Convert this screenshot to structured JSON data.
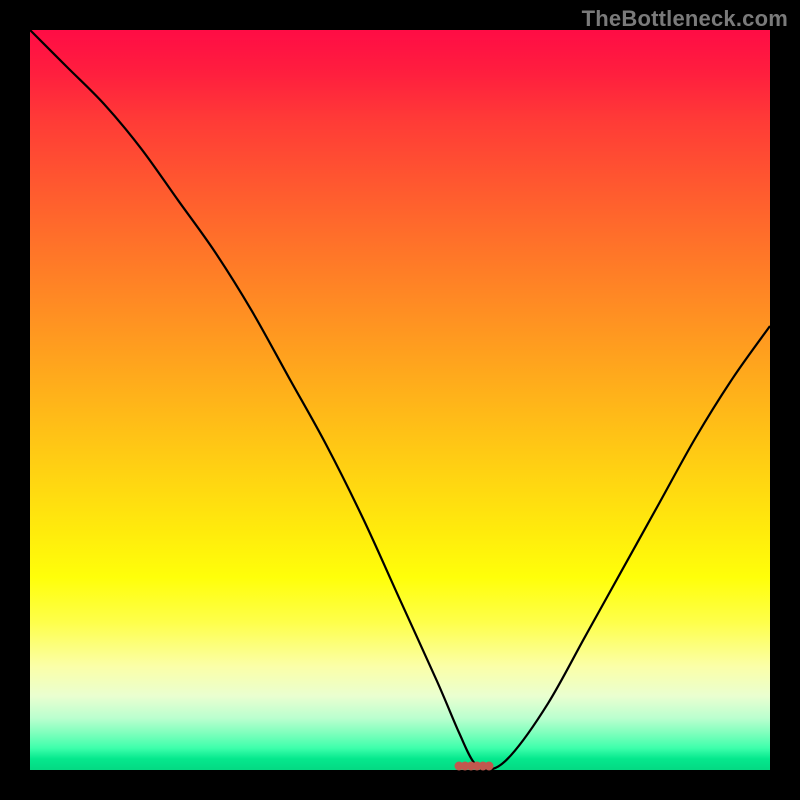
{
  "watermark": "TheBottleneck.com",
  "chart_data": {
    "type": "line",
    "title": "",
    "xlabel": "",
    "ylabel": "",
    "xlim": [
      0,
      100
    ],
    "ylim": [
      0,
      100
    ],
    "grid": false,
    "legend": false,
    "background_gradient": {
      "top": "#ff0c45",
      "mid": "#ffec0c",
      "bottom": "#04d983"
    },
    "series": [
      {
        "name": "bottleneck-curve",
        "color": "#000000",
        "x": [
          0,
          5,
          10,
          15,
          20,
          25,
          30,
          35,
          40,
          45,
          50,
          55,
          58,
          60,
          62,
          65,
          70,
          75,
          80,
          85,
          90,
          95,
          100
        ],
        "y": [
          100,
          95,
          90,
          84,
          77,
          70,
          62,
          53,
          44,
          34,
          23,
          12,
          5,
          1,
          0,
          2,
          9,
          18,
          27,
          36,
          45,
          53,
          60
        ]
      }
    ],
    "marker": {
      "name": "optimal-point",
      "color": "#c1584e",
      "x_center": 60,
      "y": 0.5,
      "dot_count": 6
    }
  }
}
